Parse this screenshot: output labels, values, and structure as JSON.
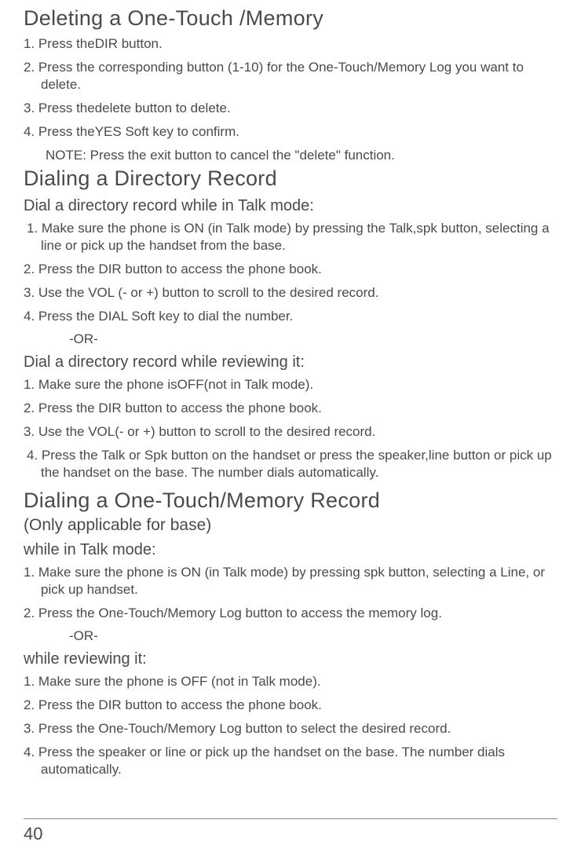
{
  "section1": {
    "heading": "Deleting a One-Touch /Memory",
    "steps": [
      "1.  Press theDIR button.",
      "2.  Press the corresponding button (1-10) for the One-Touch/Memory Log you want to delete.",
      "3.  Press thedelete button to delete.",
      "4.  Press theYES Soft key to confirm."
    ],
    "note": "NOTE: Press the exit button to cancel the \"delete\" function."
  },
  "section2": {
    "heading": "Dialing a Directory Record",
    "sub1_title": "Dial a directory record while in Talk mode:",
    "sub1_steps": [
      "1. Make sure the phone is ON (in Talk mode) by pressing the Talk,spk button, selecting a line or pick up the handset from the base.",
      "2. Press the DIR button to access the phone book.",
      "3. Use the VOL (- or +) button to scroll to the desired record.",
      "4. Press the DIAL Soft key to dial the number."
    ],
    "or": "-OR-",
    "sub2_title": "Dial a directory record while reviewing it:",
    "sub2_steps": [
      "1. Make sure the phone isOFF(not in Talk mode).",
      "2. Press the DIR button to access the phone book.",
      "3. Use the VOL(- or +) button to scroll to the desired record.",
      "4. Press the Talk or Spk button on the handset or press the speaker,line  button or pick up the handset on the base. The number dials automatically."
    ]
  },
  "section3": {
    "heading": "Dialing a One-Touch/Memory Record",
    "subheading": "(Only applicable for base)",
    "sub1_title": "while in Talk mode:",
    "sub1_steps": [
      "1.  Make sure the phone is ON (in Talk mode) by pressing spk button, selecting a Line, or pick up handset.",
      "2.  Press the One-Touch/Memory Log button to access the memory log."
    ],
    "or": "-OR-",
    "sub2_title": "while reviewing it:",
    "sub2_steps": [
      "1.  Make sure the phone is OFF (not in Talk mode).",
      "2.  Press the DIR button to access the phone book.",
      "3.  Press the One-Touch/Memory Log button to select the desired record.",
      "4.  Press the speaker or line  or pick up the handset on the base. The number dials automatically."
    ]
  },
  "page_number": "40"
}
